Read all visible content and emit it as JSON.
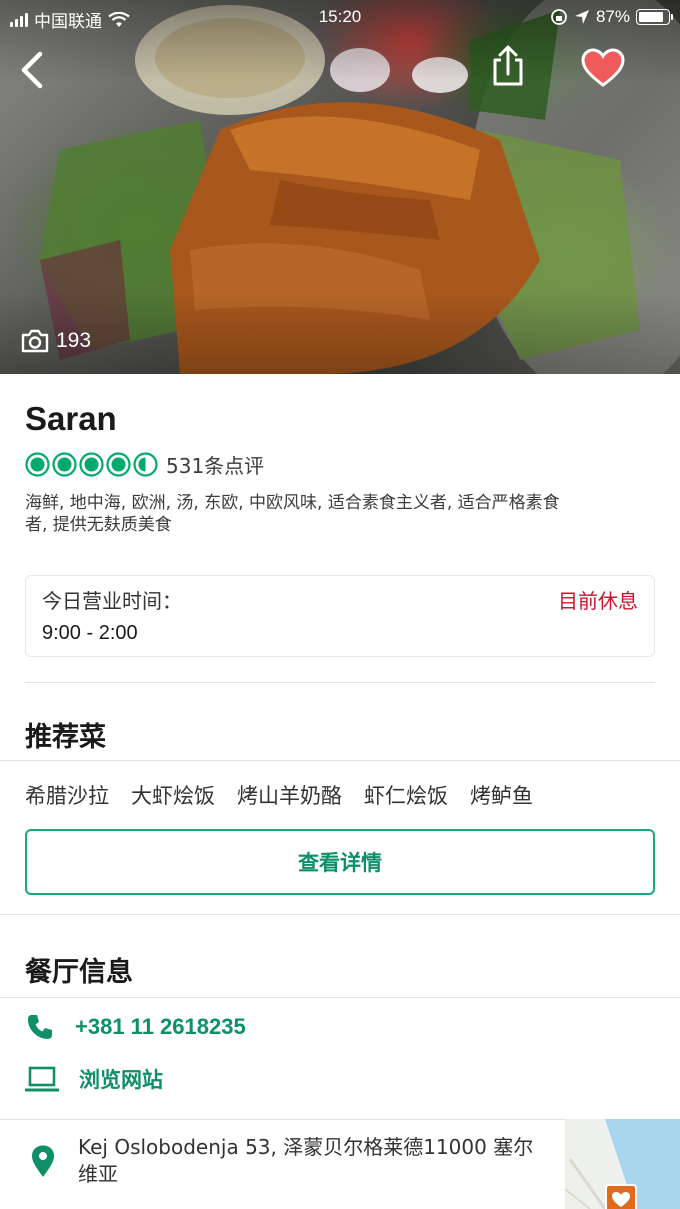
{
  "status_bar": {
    "carrier": "中国联通",
    "time": "15:20",
    "battery_percent": "87%",
    "battery_level": 0.87
  },
  "hero": {
    "photo_count": "193"
  },
  "restaurant": {
    "name": "Saran",
    "rating": 4.5,
    "rating_max": 5,
    "review_count": "531条点评",
    "cuisines": "海鲜, 地中海, 欧洲, 汤, 东欧, 中欧风味, 适合素食主义者, 适合严格素食者, 提供无麸质美食"
  },
  "hours": {
    "label": "今日营业时间：",
    "value": "9:00 - 2:00",
    "status": "目前休息"
  },
  "recommended": {
    "title": "推荐菜",
    "dishes": [
      "希腊沙拉",
      "大虾烩饭",
      "烤山羊奶酪",
      "虾仁烩饭",
      "烤鲈鱼"
    ],
    "details_button": "查看详情"
  },
  "info": {
    "title": "餐厅信息",
    "phone": "+381 11 2618235",
    "website": "浏览网站",
    "address": "Kej Oslobodenja 53, 泽蒙贝尔格莱德11000 塞尔维亚"
  },
  "colors": {
    "accent_green": "#0e8f67",
    "bubble_green": "#00aa6c",
    "closed_red": "#d0112b",
    "heart_red": "#ef5b5b"
  },
  "icons": [
    "back-icon",
    "share-icon",
    "heart-icon",
    "camera-icon",
    "phone-icon",
    "laptop-icon",
    "location-pin-icon"
  ]
}
